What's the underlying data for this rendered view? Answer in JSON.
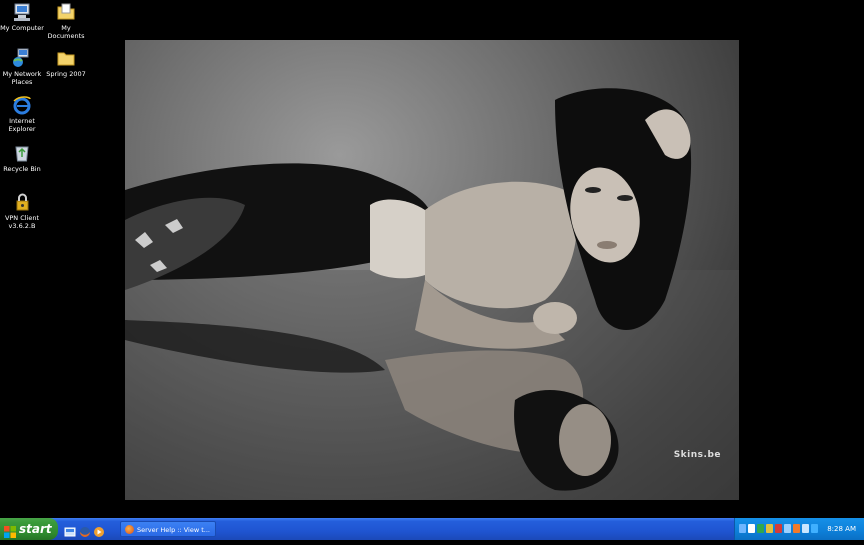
{
  "desktop": {
    "icons": [
      {
        "label": "My Computer",
        "icon": "my-computer-icon"
      },
      {
        "label": "My Documents",
        "icon": "my-documents-icon"
      },
      {
        "label": "My Network Places",
        "icon": "network-places-icon"
      },
      {
        "label": "Spring 2007",
        "icon": "folder-icon"
      },
      {
        "label": "Internet Explorer",
        "icon": "internet-explorer-icon"
      },
      {
        "label": "Recycle Bin",
        "icon": "recycle-bin-icon"
      },
      {
        "label": "VPN Client v3.6.2.B",
        "icon": "vpn-client-icon"
      }
    ],
    "wallpaper_watermark": "Skins.be"
  },
  "taskbar": {
    "start_label": "start",
    "quick_launch": [
      "show-desktop-icon",
      "firefox-icon",
      "media-player-icon"
    ],
    "tasks": [
      {
        "label": "Server Help :: View t...",
        "icon": "firefox-icon"
      }
    ],
    "clock": "8:28 AM"
  },
  "colors": {
    "taskbar_blue": "#245edb",
    "start_green": "#3a9a3a",
    "tray_blue": "#0d7fd8",
    "desktop_bg": "#000000"
  }
}
